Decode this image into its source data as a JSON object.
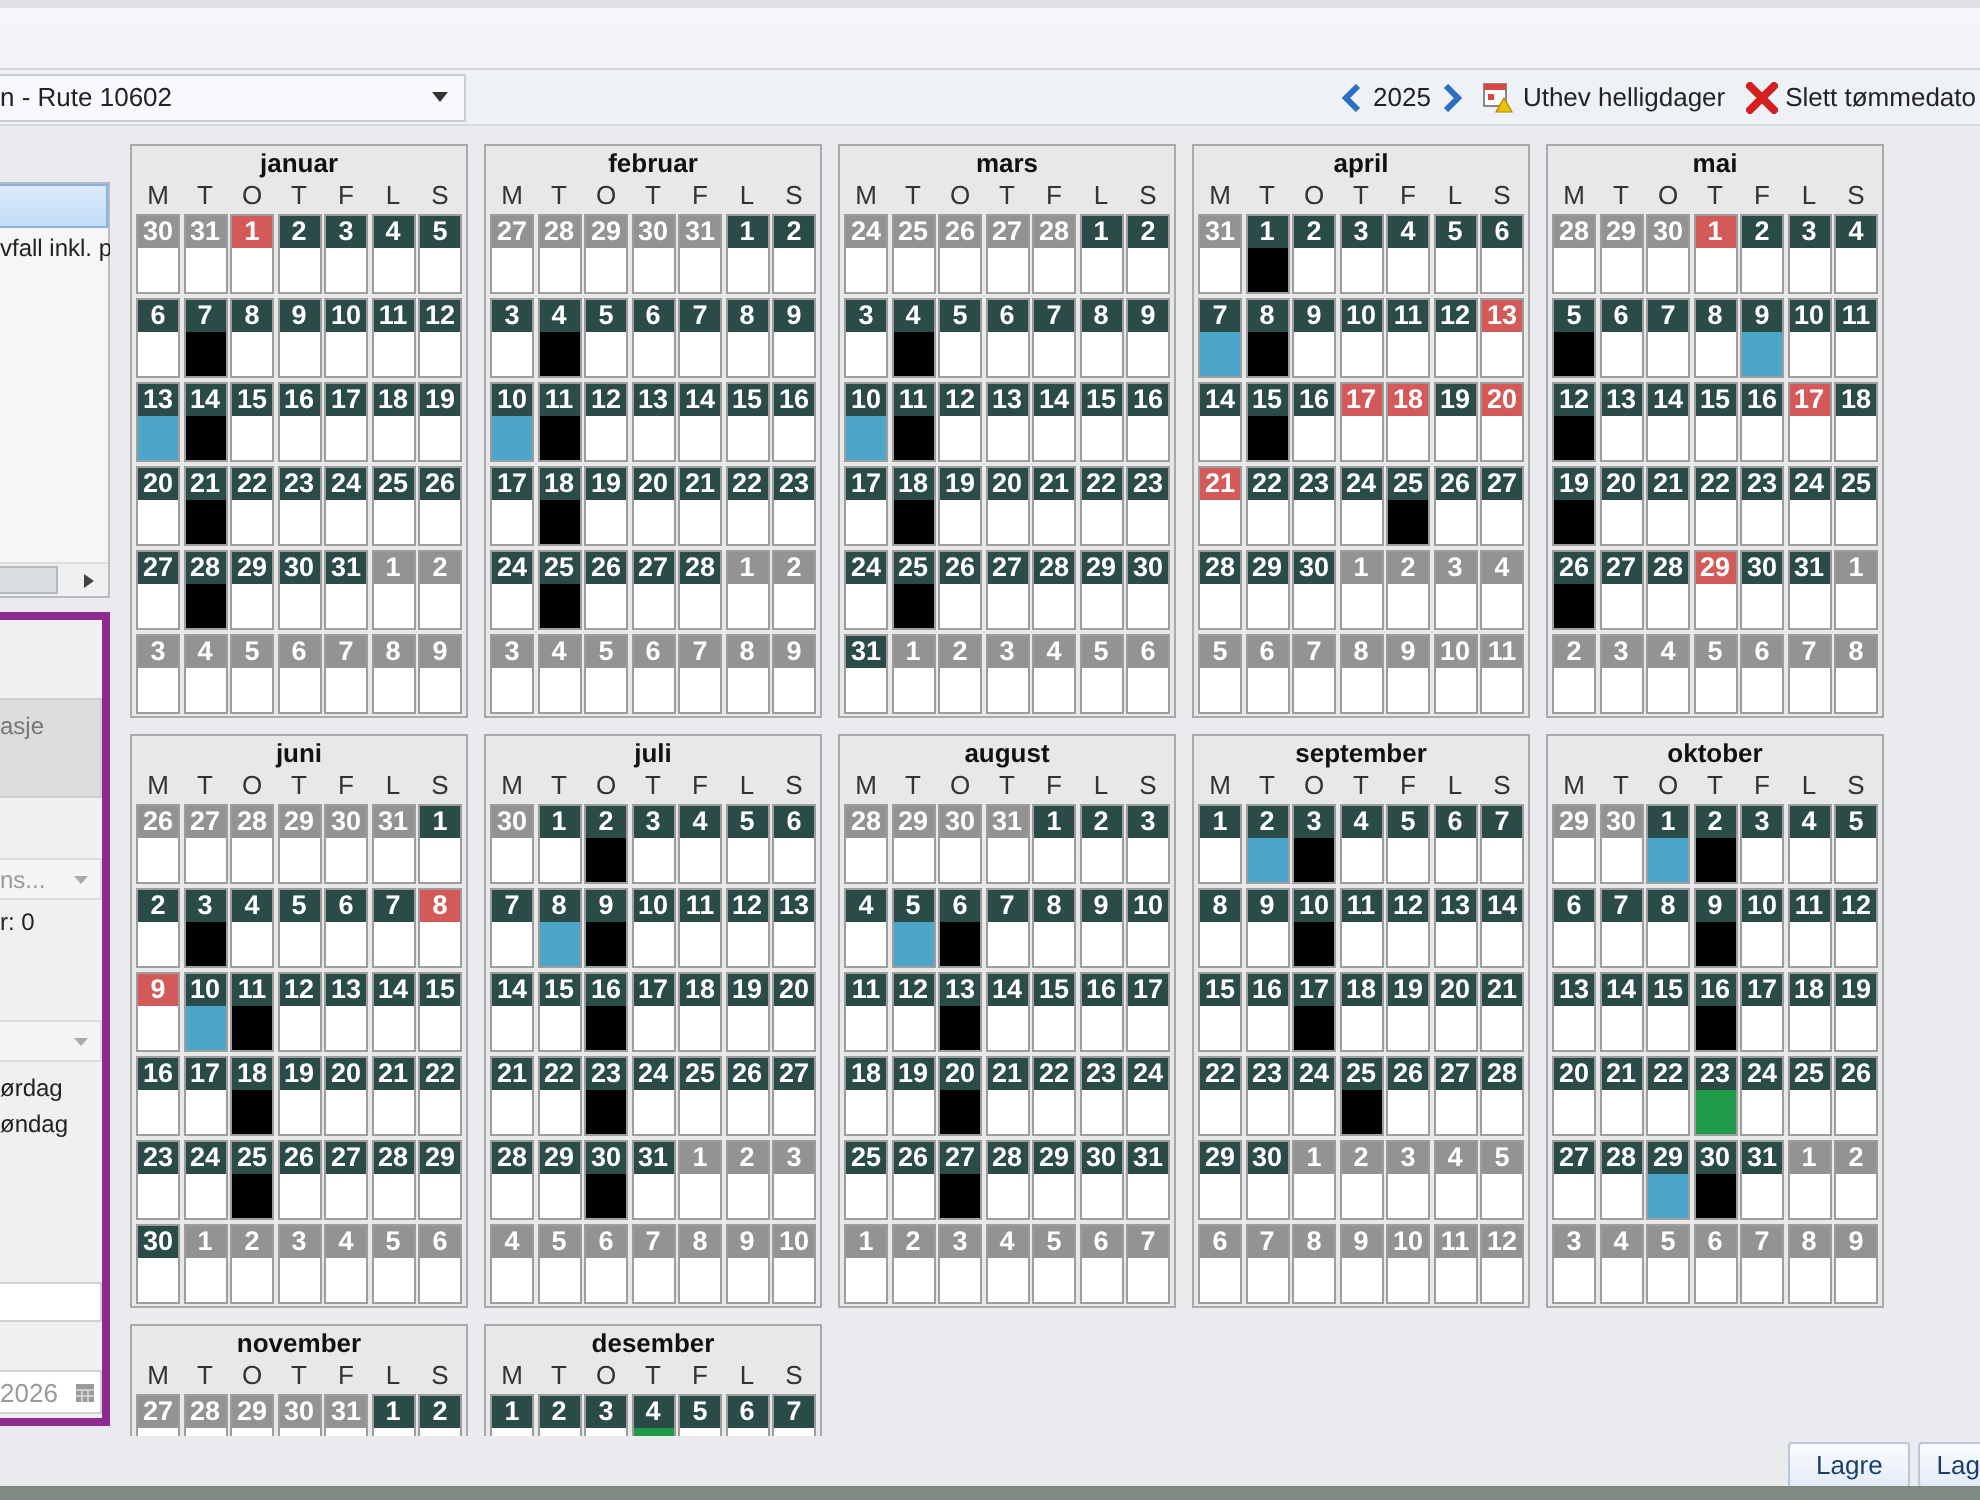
{
  "route_select": {
    "value": "n - Rute 10602"
  },
  "toolbar": {
    "year": "2025",
    "highlight_label": "Uthev helligdager",
    "delete_label": "Slett tømmedato"
  },
  "side": {
    "list_items": [
      {
        "selected": true
      },
      {
        "text": "vfall inkl. p",
        "selected": false
      }
    ],
    "info_box": "asje",
    "select_value": "ns...",
    "count_text": "r: 0",
    "options": [
      "ørdag",
      "øndag"
    ],
    "date_value": "2026"
  },
  "months": [
    {
      "name": "januar",
      "weekdays": [
        "M",
        "T",
        "O",
        "T",
        "F",
        "L",
        "S"
      ],
      "days": [
        {
          "day": "30",
          "kind": "other"
        },
        {
          "day": "31",
          "kind": "other"
        },
        {
          "day": "1",
          "kind": "holiday"
        },
        {
          "day": "2",
          "kind": "day"
        },
        {
          "day": "3",
          "kind": "day"
        },
        {
          "day": "4",
          "kind": "day"
        },
        {
          "day": "5",
          "kind": "day"
        },
        {
          "day": "6",
          "kind": "day"
        },
        {
          "day": "7",
          "kind": "day",
          "color": "#000000"
        },
        {
          "day": "8",
          "kind": "day"
        },
        {
          "day": "9",
          "kind": "day"
        },
        {
          "day": "10",
          "kind": "day"
        },
        {
          "day": "11",
          "kind": "day"
        },
        {
          "day": "12",
          "kind": "day"
        },
        {
          "day": "13",
          "kind": "day",
          "color": "#4ba6c9"
        },
        {
          "day": "14",
          "kind": "day",
          "color": "#000000"
        },
        {
          "day": "15",
          "kind": "day"
        },
        {
          "day": "16",
          "kind": "day"
        },
        {
          "day": "17",
          "kind": "day"
        },
        {
          "day": "18",
          "kind": "day"
        },
        {
          "day": "19",
          "kind": "day"
        },
        {
          "day": "20",
          "kind": "day"
        },
        {
          "day": "21",
          "kind": "day",
          "color": "#000000"
        },
        {
          "day": "22",
          "kind": "day"
        },
        {
          "day": "23",
          "kind": "day"
        },
        {
          "day": "24",
          "kind": "day"
        },
        {
          "day": "25",
          "kind": "day"
        },
        {
          "day": "26",
          "kind": "day"
        },
        {
          "day": "27",
          "kind": "day"
        },
        {
          "day": "28",
          "kind": "day",
          "color": "#000000"
        },
        {
          "day": "29",
          "kind": "day"
        },
        {
          "day": "30",
          "kind": "day"
        },
        {
          "day": "31",
          "kind": "day"
        },
        {
          "day": "1",
          "kind": "other"
        },
        {
          "day": "2",
          "kind": "other"
        },
        {
          "day": "3",
          "kind": "other"
        },
        {
          "day": "4",
          "kind": "other"
        },
        {
          "day": "5",
          "kind": "other"
        },
        {
          "day": "6",
          "kind": "other"
        },
        {
          "day": "7",
          "kind": "other"
        },
        {
          "day": "8",
          "kind": "other"
        },
        {
          "day": "9",
          "kind": "other"
        }
      ]
    },
    {
      "name": "februar",
      "weekdays": [
        "M",
        "T",
        "O",
        "T",
        "F",
        "L",
        "S"
      ],
      "days": [
        {
          "day": "27",
          "kind": "other"
        },
        {
          "day": "28",
          "kind": "other"
        },
        {
          "day": "29",
          "kind": "other"
        },
        {
          "day": "30",
          "kind": "other"
        },
        {
          "day": "31",
          "kind": "other"
        },
        {
          "day": "1",
          "kind": "day"
        },
        {
          "day": "2",
          "kind": "day"
        },
        {
          "day": "3",
          "kind": "day"
        },
        {
          "day": "4",
          "kind": "day",
          "color": "#000000"
        },
        {
          "day": "5",
          "kind": "day"
        },
        {
          "day": "6",
          "kind": "day"
        },
        {
          "day": "7",
          "kind": "day"
        },
        {
          "day": "8",
          "kind": "day"
        },
        {
          "day": "9",
          "kind": "day"
        },
        {
          "day": "10",
          "kind": "day",
          "color": "#4ba6c9"
        },
        {
          "day": "11",
          "kind": "day",
          "color": "#000000"
        },
        {
          "day": "12",
          "kind": "day"
        },
        {
          "day": "13",
          "kind": "day"
        },
        {
          "day": "14",
          "kind": "day"
        },
        {
          "day": "15",
          "kind": "day"
        },
        {
          "day": "16",
          "kind": "day"
        },
        {
          "day": "17",
          "kind": "day"
        },
        {
          "day": "18",
          "kind": "day",
          "color": "#000000"
        },
        {
          "day": "19",
          "kind": "day"
        },
        {
          "day": "20",
          "kind": "day"
        },
        {
          "day": "21",
          "kind": "day"
        },
        {
          "day": "22",
          "kind": "day"
        },
        {
          "day": "23",
          "kind": "day"
        },
        {
          "day": "24",
          "kind": "day"
        },
        {
          "day": "25",
          "kind": "day",
          "color": "#000000"
        },
        {
          "day": "26",
          "kind": "day"
        },
        {
          "day": "27",
          "kind": "day"
        },
        {
          "day": "28",
          "kind": "day"
        },
        {
          "day": "1",
          "kind": "other"
        },
        {
          "day": "2",
          "kind": "other"
        },
        {
          "day": "3",
          "kind": "other"
        },
        {
          "day": "4",
          "kind": "other"
        },
        {
          "day": "5",
          "kind": "other"
        },
        {
          "day": "6",
          "kind": "other"
        },
        {
          "day": "7",
          "kind": "other"
        },
        {
          "day": "8",
          "kind": "other"
        },
        {
          "day": "9",
          "kind": "other"
        }
      ]
    },
    {
      "name": "mars",
      "weekdays": [
        "M",
        "T",
        "O",
        "T",
        "F",
        "L",
        "S"
      ],
      "days": [
        {
          "day": "24",
          "kind": "other"
        },
        {
          "day": "25",
          "kind": "other"
        },
        {
          "day": "26",
          "kind": "other"
        },
        {
          "day": "27",
          "kind": "other"
        },
        {
          "day": "28",
          "kind": "other"
        },
        {
          "day": "1",
          "kind": "day"
        },
        {
          "day": "2",
          "kind": "day"
        },
        {
          "day": "3",
          "kind": "day"
        },
        {
          "day": "4",
          "kind": "day",
          "color": "#000000"
        },
        {
          "day": "5",
          "kind": "day"
        },
        {
          "day": "6",
          "kind": "day"
        },
        {
          "day": "7",
          "kind": "day"
        },
        {
          "day": "8",
          "kind": "day"
        },
        {
          "day": "9",
          "kind": "day"
        },
        {
          "day": "10",
          "kind": "day",
          "color": "#4ba6c9"
        },
        {
          "day": "11",
          "kind": "day",
          "color": "#000000"
        },
        {
          "day": "12",
          "kind": "day"
        },
        {
          "day": "13",
          "kind": "day"
        },
        {
          "day": "14",
          "kind": "day"
        },
        {
          "day": "15",
          "kind": "day"
        },
        {
          "day": "16",
          "kind": "day"
        },
        {
          "day": "17",
          "kind": "day"
        },
        {
          "day": "18",
          "kind": "day",
          "color": "#000000"
        },
        {
          "day": "19",
          "kind": "day"
        },
        {
          "day": "20",
          "kind": "day"
        },
        {
          "day": "21",
          "kind": "day"
        },
        {
          "day": "22",
          "kind": "day"
        },
        {
          "day": "23",
          "kind": "day"
        },
        {
          "day": "24",
          "kind": "day"
        },
        {
          "day": "25",
          "kind": "day",
          "color": "#000000"
        },
        {
          "day": "26",
          "kind": "day"
        },
        {
          "day": "27",
          "kind": "day"
        },
        {
          "day": "28",
          "kind": "day"
        },
        {
          "day": "29",
          "kind": "day"
        },
        {
          "day": "30",
          "kind": "day"
        },
        {
          "day": "31",
          "kind": "day"
        },
        {
          "day": "1",
          "kind": "other"
        },
        {
          "day": "2",
          "kind": "other"
        },
        {
          "day": "3",
          "kind": "other"
        },
        {
          "day": "4",
          "kind": "other"
        },
        {
          "day": "5",
          "kind": "other"
        },
        {
          "day": "6",
          "kind": "other"
        }
      ]
    },
    {
      "name": "april",
      "weekdays": [
        "M",
        "T",
        "O",
        "T",
        "F",
        "L",
        "S"
      ],
      "days": [
        {
          "day": "31",
          "kind": "other"
        },
        {
          "day": "1",
          "kind": "day",
          "color": "#000000"
        },
        {
          "day": "2",
          "kind": "day"
        },
        {
          "day": "3",
          "kind": "day"
        },
        {
          "day": "4",
          "kind": "day"
        },
        {
          "day": "5",
          "kind": "day"
        },
        {
          "day": "6",
          "kind": "day"
        },
        {
          "day": "7",
          "kind": "day",
          "color": "#4ba6c9"
        },
        {
          "day": "8",
          "kind": "day",
          "color": "#000000"
        },
        {
          "day": "9",
          "kind": "day"
        },
        {
          "day": "10",
          "kind": "day"
        },
        {
          "day": "11",
          "kind": "day"
        },
        {
          "day": "12",
          "kind": "day"
        },
        {
          "day": "13",
          "kind": "holiday"
        },
        {
          "day": "14",
          "kind": "day"
        },
        {
          "day": "15",
          "kind": "day",
          "color": "#000000"
        },
        {
          "day": "16",
          "kind": "day"
        },
        {
          "day": "17",
          "kind": "holiday"
        },
        {
          "day": "18",
          "kind": "holiday"
        },
        {
          "day": "19",
          "kind": "day"
        },
        {
          "day": "20",
          "kind": "holiday"
        },
        {
          "day": "21",
          "kind": "holiday"
        },
        {
          "day": "22",
          "kind": "day"
        },
        {
          "day": "23",
          "kind": "day"
        },
        {
          "day": "24",
          "kind": "day"
        },
        {
          "day": "25",
          "kind": "day",
          "color": "#000000"
        },
        {
          "day": "26",
          "kind": "day"
        },
        {
          "day": "27",
          "kind": "day"
        },
        {
          "day": "28",
          "kind": "day"
        },
        {
          "day": "29",
          "kind": "day"
        },
        {
          "day": "30",
          "kind": "day"
        },
        {
          "day": "1",
          "kind": "other"
        },
        {
          "day": "2",
          "kind": "other"
        },
        {
          "day": "3",
          "kind": "other"
        },
        {
          "day": "4",
          "kind": "other"
        },
        {
          "day": "5",
          "kind": "other"
        },
        {
          "day": "6",
          "kind": "other"
        },
        {
          "day": "7",
          "kind": "other"
        },
        {
          "day": "8",
          "kind": "other"
        },
        {
          "day": "9",
          "kind": "other"
        },
        {
          "day": "10",
          "kind": "other"
        },
        {
          "day": "11",
          "kind": "other"
        }
      ]
    },
    {
      "name": "mai",
      "weekdays": [
        "M",
        "T",
        "O",
        "T",
        "F",
        "L",
        "S"
      ],
      "days": [
        {
          "day": "28",
          "kind": "other"
        },
        {
          "day": "29",
          "kind": "other"
        },
        {
          "day": "30",
          "kind": "other"
        },
        {
          "day": "1",
          "kind": "holiday"
        },
        {
          "day": "2",
          "kind": "day"
        },
        {
          "day": "3",
          "kind": "day"
        },
        {
          "day": "4",
          "kind": "day"
        },
        {
          "day": "5",
          "kind": "day",
          "color": "#000000"
        },
        {
          "day": "6",
          "kind": "day"
        },
        {
          "day": "7",
          "kind": "day"
        },
        {
          "day": "8",
          "kind": "day"
        },
        {
          "day": "9",
          "kind": "day",
          "color": "#4ba6c9"
        },
        {
          "day": "10",
          "kind": "day"
        },
        {
          "day": "11",
          "kind": "day"
        },
        {
          "day": "12",
          "kind": "day",
          "color": "#000000"
        },
        {
          "day": "13",
          "kind": "day"
        },
        {
          "day": "14",
          "kind": "day"
        },
        {
          "day": "15",
          "kind": "day"
        },
        {
          "day": "16",
          "kind": "day"
        },
        {
          "day": "17",
          "kind": "holiday"
        },
        {
          "day": "18",
          "kind": "day"
        },
        {
          "day": "19",
          "kind": "day",
          "color": "#000000"
        },
        {
          "day": "20",
          "kind": "day"
        },
        {
          "day": "21",
          "kind": "day"
        },
        {
          "day": "22",
          "kind": "day"
        },
        {
          "day": "23",
          "kind": "day"
        },
        {
          "day": "24",
          "kind": "day"
        },
        {
          "day": "25",
          "kind": "day"
        },
        {
          "day": "26",
          "kind": "day",
          "color": "#000000"
        },
        {
          "day": "27",
          "kind": "day"
        },
        {
          "day": "28",
          "kind": "day"
        },
        {
          "day": "29",
          "kind": "holiday"
        },
        {
          "day": "30",
          "kind": "day"
        },
        {
          "day": "31",
          "kind": "day"
        },
        {
          "day": "1",
          "kind": "other"
        },
        {
          "day": "2",
          "kind": "other"
        },
        {
          "day": "3",
          "kind": "other"
        },
        {
          "day": "4",
          "kind": "other"
        },
        {
          "day": "5",
          "kind": "other"
        },
        {
          "day": "6",
          "kind": "other"
        },
        {
          "day": "7",
          "kind": "other"
        },
        {
          "day": "8",
          "kind": "other"
        }
      ]
    },
    {
      "name": "juni",
      "weekdays": [
        "M",
        "T",
        "O",
        "T",
        "F",
        "L",
        "S"
      ],
      "days": [
        {
          "day": "26",
          "kind": "other"
        },
        {
          "day": "27",
          "kind": "other"
        },
        {
          "day": "28",
          "kind": "other"
        },
        {
          "day": "29",
          "kind": "other"
        },
        {
          "day": "30",
          "kind": "other"
        },
        {
          "day": "31",
          "kind": "other"
        },
        {
          "day": "1",
          "kind": "day"
        },
        {
          "day": "2",
          "kind": "day"
        },
        {
          "day": "3",
          "kind": "day",
          "color": "#000000"
        },
        {
          "day": "4",
          "kind": "day"
        },
        {
          "day": "5",
          "kind": "day"
        },
        {
          "day": "6",
          "kind": "day"
        },
        {
          "day": "7",
          "kind": "day"
        },
        {
          "day": "8",
          "kind": "holiday"
        },
        {
          "day": "9",
          "kind": "holiday"
        },
        {
          "day": "10",
          "kind": "day",
          "color": "#4ba6c9"
        },
        {
          "day": "11",
          "kind": "day",
          "color": "#000000"
        },
        {
          "day": "12",
          "kind": "day"
        },
        {
          "day": "13",
          "kind": "day"
        },
        {
          "day": "14",
          "kind": "day"
        },
        {
          "day": "15",
          "kind": "day"
        },
        {
          "day": "16",
          "kind": "day"
        },
        {
          "day": "17",
          "kind": "day"
        },
        {
          "day": "18",
          "kind": "day",
          "color": "#000000"
        },
        {
          "day": "19",
          "kind": "day"
        },
        {
          "day": "20",
          "kind": "day"
        },
        {
          "day": "21",
          "kind": "day"
        },
        {
          "day": "22",
          "kind": "day"
        },
        {
          "day": "23",
          "kind": "day"
        },
        {
          "day": "24",
          "kind": "day"
        },
        {
          "day": "25",
          "kind": "day",
          "color": "#000000"
        },
        {
          "day": "26",
          "kind": "day"
        },
        {
          "day": "27",
          "kind": "day"
        },
        {
          "day": "28",
          "kind": "day"
        },
        {
          "day": "29",
          "kind": "day"
        },
        {
          "day": "30",
          "kind": "day"
        },
        {
          "day": "1",
          "kind": "other"
        },
        {
          "day": "2",
          "kind": "other"
        },
        {
          "day": "3",
          "kind": "other"
        },
        {
          "day": "4",
          "kind": "other"
        },
        {
          "day": "5",
          "kind": "other"
        },
        {
          "day": "6",
          "kind": "other"
        }
      ]
    },
    {
      "name": "juli",
      "weekdays": [
        "M",
        "T",
        "O",
        "T",
        "F",
        "L",
        "S"
      ],
      "days": [
        {
          "day": "30",
          "kind": "other"
        },
        {
          "day": "1",
          "kind": "day"
        },
        {
          "day": "2",
          "kind": "day",
          "color": "#000000"
        },
        {
          "day": "3",
          "kind": "day"
        },
        {
          "day": "4",
          "kind": "day"
        },
        {
          "day": "5",
          "kind": "day"
        },
        {
          "day": "6",
          "kind": "day"
        },
        {
          "day": "7",
          "kind": "day"
        },
        {
          "day": "8",
          "kind": "day",
          "color": "#4ba6c9"
        },
        {
          "day": "9",
          "kind": "day",
          "color": "#000000"
        },
        {
          "day": "10",
          "kind": "day"
        },
        {
          "day": "11",
          "kind": "day"
        },
        {
          "day": "12",
          "kind": "day"
        },
        {
          "day": "13",
          "kind": "day"
        },
        {
          "day": "14",
          "kind": "day"
        },
        {
          "day": "15",
          "kind": "day"
        },
        {
          "day": "16",
          "kind": "day",
          "color": "#000000"
        },
        {
          "day": "17",
          "kind": "day"
        },
        {
          "day": "18",
          "kind": "day"
        },
        {
          "day": "19",
          "kind": "day"
        },
        {
          "day": "20",
          "kind": "day"
        },
        {
          "day": "21",
          "kind": "day"
        },
        {
          "day": "22",
          "kind": "day"
        },
        {
          "day": "23",
          "kind": "day",
          "color": "#000000"
        },
        {
          "day": "24",
          "kind": "day"
        },
        {
          "day": "25",
          "kind": "day"
        },
        {
          "day": "26",
          "kind": "day"
        },
        {
          "day": "27",
          "kind": "day"
        },
        {
          "day": "28",
          "kind": "day"
        },
        {
          "day": "29",
          "kind": "day"
        },
        {
          "day": "30",
          "kind": "day",
          "color": "#000000"
        },
        {
          "day": "31",
          "kind": "day"
        },
        {
          "day": "1",
          "kind": "other"
        },
        {
          "day": "2",
          "kind": "other"
        },
        {
          "day": "3",
          "kind": "other"
        },
        {
          "day": "4",
          "kind": "other"
        },
        {
          "day": "5",
          "kind": "other"
        },
        {
          "day": "6",
          "kind": "other"
        },
        {
          "day": "7",
          "kind": "other"
        },
        {
          "day": "8",
          "kind": "other"
        },
        {
          "day": "9",
          "kind": "other"
        },
        {
          "day": "10",
          "kind": "other"
        }
      ]
    },
    {
      "name": "august",
      "weekdays": [
        "M",
        "T",
        "O",
        "T",
        "F",
        "L",
        "S"
      ],
      "days": [
        {
          "day": "28",
          "kind": "other"
        },
        {
          "day": "29",
          "kind": "other"
        },
        {
          "day": "30",
          "kind": "other"
        },
        {
          "day": "31",
          "kind": "other"
        },
        {
          "day": "1",
          "kind": "day"
        },
        {
          "day": "2",
          "kind": "day"
        },
        {
          "day": "3",
          "kind": "day"
        },
        {
          "day": "4",
          "kind": "day"
        },
        {
          "day": "5",
          "kind": "day",
          "color": "#4ba6c9"
        },
        {
          "day": "6",
          "kind": "day",
          "color": "#000000"
        },
        {
          "day": "7",
          "kind": "day"
        },
        {
          "day": "8",
          "kind": "day"
        },
        {
          "day": "9",
          "kind": "day"
        },
        {
          "day": "10",
          "kind": "day"
        },
        {
          "day": "11",
          "kind": "day"
        },
        {
          "day": "12",
          "kind": "day"
        },
        {
          "day": "13",
          "kind": "day",
          "color": "#000000"
        },
        {
          "day": "14",
          "kind": "day"
        },
        {
          "day": "15",
          "kind": "day"
        },
        {
          "day": "16",
          "kind": "day"
        },
        {
          "day": "17",
          "kind": "day"
        },
        {
          "day": "18",
          "kind": "day"
        },
        {
          "day": "19",
          "kind": "day"
        },
        {
          "day": "20",
          "kind": "day",
          "color": "#000000"
        },
        {
          "day": "21",
          "kind": "day"
        },
        {
          "day": "22",
          "kind": "day"
        },
        {
          "day": "23",
          "kind": "day"
        },
        {
          "day": "24",
          "kind": "day"
        },
        {
          "day": "25",
          "kind": "day"
        },
        {
          "day": "26",
          "kind": "day"
        },
        {
          "day": "27",
          "kind": "day",
          "color": "#000000"
        },
        {
          "day": "28",
          "kind": "day"
        },
        {
          "day": "29",
          "kind": "day"
        },
        {
          "day": "30",
          "kind": "day"
        },
        {
          "day": "31",
          "kind": "day"
        },
        {
          "day": "1",
          "kind": "other"
        },
        {
          "day": "2",
          "kind": "other"
        },
        {
          "day": "3",
          "kind": "other"
        },
        {
          "day": "4",
          "kind": "other"
        },
        {
          "day": "5",
          "kind": "other"
        },
        {
          "day": "6",
          "kind": "other"
        },
        {
          "day": "7",
          "kind": "other"
        }
      ]
    },
    {
      "name": "september",
      "weekdays": [
        "M",
        "T",
        "O",
        "T",
        "F",
        "L",
        "S"
      ],
      "days": [
        {
          "day": "1",
          "kind": "day"
        },
        {
          "day": "2",
          "kind": "day",
          "color": "#4ba6c9"
        },
        {
          "day": "3",
          "kind": "day",
          "color": "#000000"
        },
        {
          "day": "4",
          "kind": "day"
        },
        {
          "day": "5",
          "kind": "day"
        },
        {
          "day": "6",
          "kind": "day"
        },
        {
          "day": "7",
          "kind": "day"
        },
        {
          "day": "8",
          "kind": "day"
        },
        {
          "day": "9",
          "kind": "day"
        },
        {
          "day": "10",
          "kind": "day",
          "color": "#000000"
        },
        {
          "day": "11",
          "kind": "day"
        },
        {
          "day": "12",
          "kind": "day"
        },
        {
          "day": "13",
          "kind": "day"
        },
        {
          "day": "14",
          "kind": "day"
        },
        {
          "day": "15",
          "kind": "day"
        },
        {
          "day": "16",
          "kind": "day"
        },
        {
          "day": "17",
          "kind": "day",
          "color": "#000000"
        },
        {
          "day": "18",
          "kind": "day"
        },
        {
          "day": "19",
          "kind": "day"
        },
        {
          "day": "20",
          "kind": "day"
        },
        {
          "day": "21",
          "kind": "day"
        },
        {
          "day": "22",
          "kind": "day"
        },
        {
          "day": "23",
          "kind": "day"
        },
        {
          "day": "24",
          "kind": "day"
        },
        {
          "day": "25",
          "kind": "day",
          "color": "#000000"
        },
        {
          "day": "26",
          "kind": "day"
        },
        {
          "day": "27",
          "kind": "day"
        },
        {
          "day": "28",
          "kind": "day"
        },
        {
          "day": "29",
          "kind": "day"
        },
        {
          "day": "30",
          "kind": "day"
        },
        {
          "day": "1",
          "kind": "other"
        },
        {
          "day": "2",
          "kind": "other"
        },
        {
          "day": "3",
          "kind": "other"
        },
        {
          "day": "4",
          "kind": "other"
        },
        {
          "day": "5",
          "kind": "other"
        },
        {
          "day": "6",
          "kind": "other"
        },
        {
          "day": "7",
          "kind": "other"
        },
        {
          "day": "8",
          "kind": "other"
        },
        {
          "day": "9",
          "kind": "other"
        },
        {
          "day": "10",
          "kind": "other"
        },
        {
          "day": "11",
          "kind": "other"
        },
        {
          "day": "12",
          "kind": "other"
        }
      ]
    },
    {
      "name": "oktober",
      "weekdays": [
        "M",
        "T",
        "O",
        "T",
        "F",
        "L",
        "S"
      ],
      "days": [
        {
          "day": "29",
          "kind": "other"
        },
        {
          "day": "30",
          "kind": "other"
        },
        {
          "day": "1",
          "kind": "day",
          "color": "#4ba6c9"
        },
        {
          "day": "2",
          "kind": "day",
          "color": "#000000"
        },
        {
          "day": "3",
          "kind": "day"
        },
        {
          "day": "4",
          "kind": "day"
        },
        {
          "day": "5",
          "kind": "day"
        },
        {
          "day": "6",
          "kind": "day"
        },
        {
          "day": "7",
          "kind": "day"
        },
        {
          "day": "8",
          "kind": "day"
        },
        {
          "day": "9",
          "kind": "day",
          "color": "#000000"
        },
        {
          "day": "10",
          "kind": "day"
        },
        {
          "day": "11",
          "kind": "day"
        },
        {
          "day": "12",
          "kind": "day"
        },
        {
          "day": "13",
          "kind": "day"
        },
        {
          "day": "14",
          "kind": "day"
        },
        {
          "day": "15",
          "kind": "day"
        },
        {
          "day": "16",
          "kind": "day",
          "color": "#000000"
        },
        {
          "day": "17",
          "kind": "day"
        },
        {
          "day": "18",
          "kind": "day"
        },
        {
          "day": "19",
          "kind": "day"
        },
        {
          "day": "20",
          "kind": "day"
        },
        {
          "day": "21",
          "kind": "day"
        },
        {
          "day": "22",
          "kind": "day"
        },
        {
          "day": "23",
          "kind": "day",
          "color": "#1f9a48"
        },
        {
          "day": "24",
          "kind": "day"
        },
        {
          "day": "25",
          "kind": "day"
        },
        {
          "day": "26",
          "kind": "day"
        },
        {
          "day": "27",
          "kind": "day"
        },
        {
          "day": "28",
          "kind": "day"
        },
        {
          "day": "29",
          "kind": "day",
          "color": "#4ba6c9"
        },
        {
          "day": "30",
          "kind": "day",
          "color": "#000000"
        },
        {
          "day": "31",
          "kind": "day"
        },
        {
          "day": "1",
          "kind": "other"
        },
        {
          "day": "2",
          "kind": "other"
        },
        {
          "day": "3",
          "kind": "other"
        },
        {
          "day": "4",
          "kind": "other"
        },
        {
          "day": "5",
          "kind": "other"
        },
        {
          "day": "6",
          "kind": "other"
        },
        {
          "day": "7",
          "kind": "other"
        },
        {
          "day": "8",
          "kind": "other"
        },
        {
          "day": "9",
          "kind": "other"
        }
      ]
    },
    {
      "name": "november",
      "weekdays": [
        "M",
        "T",
        "O",
        "T",
        "F",
        "L",
        "S"
      ],
      "days": [
        {
          "day": "27",
          "kind": "other"
        },
        {
          "day": "28",
          "kind": "other"
        },
        {
          "day": "29",
          "kind": "other"
        },
        {
          "day": "30",
          "kind": "other"
        },
        {
          "day": "31",
          "kind": "other"
        },
        {
          "day": "1",
          "kind": "day"
        },
        {
          "day": "2",
          "kind": "day"
        }
      ]
    },
    {
      "name": "desember",
      "weekdays": [
        "M",
        "T",
        "O",
        "T",
        "F",
        "L",
        "S"
      ],
      "days": [
        {
          "day": "1",
          "kind": "day"
        },
        {
          "day": "2",
          "kind": "day"
        },
        {
          "day": "3",
          "kind": "day"
        },
        {
          "day": "4",
          "kind": "day",
          "color": "#1f9a48"
        },
        {
          "day": "5",
          "kind": "day"
        },
        {
          "day": "6",
          "kind": "day"
        },
        {
          "day": "7",
          "kind": "day"
        }
      ]
    }
  ],
  "buttons": [
    "Lagre",
    "Lag"
  ]
}
